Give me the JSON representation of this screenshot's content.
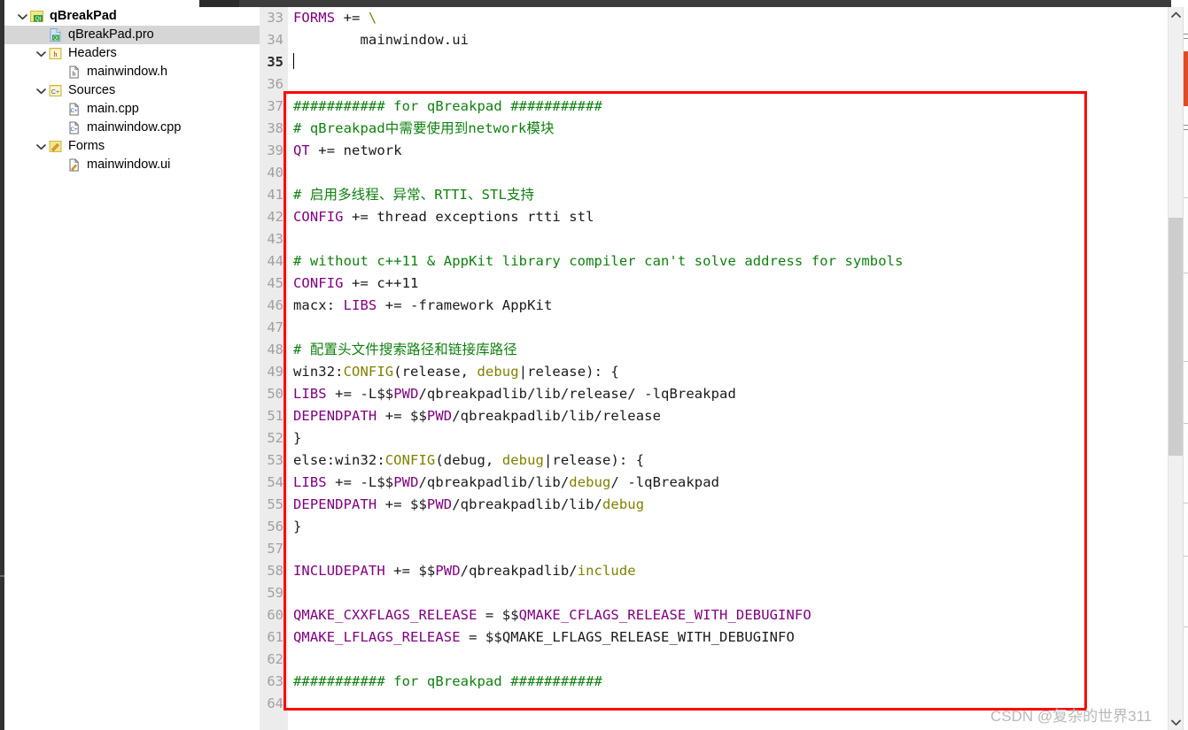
{
  "sidebar": {
    "items": [
      {
        "label": "qBreakPad",
        "icon": "qt-project-icon",
        "indent": 0,
        "chevron": "down",
        "bold": true,
        "selected": false
      },
      {
        "label": "qBreakPad.pro",
        "icon": "pro-file-icon",
        "indent": 1,
        "chevron": "none",
        "bold": false,
        "selected": true
      },
      {
        "label": "Headers",
        "icon": "headers-folder-icon",
        "indent": 1,
        "chevron": "down",
        "bold": false,
        "selected": false
      },
      {
        "label": "mainwindow.h",
        "icon": "header-file-icon",
        "indent": 2,
        "chevron": "none",
        "bold": false,
        "selected": false
      },
      {
        "label": "Sources",
        "icon": "sources-folder-icon",
        "indent": 1,
        "chevron": "down",
        "bold": false,
        "selected": false
      },
      {
        "label": "main.cpp",
        "icon": "cpp-file-icon",
        "indent": 2,
        "chevron": "none",
        "bold": false,
        "selected": false
      },
      {
        "label": "mainwindow.cpp",
        "icon": "cpp-file-icon",
        "indent": 2,
        "chevron": "none",
        "bold": false,
        "selected": false
      },
      {
        "label": "Forms",
        "icon": "forms-folder-icon",
        "indent": 1,
        "chevron": "down",
        "bold": false,
        "selected": false
      },
      {
        "label": "mainwindow.ui",
        "icon": "ui-file-icon",
        "indent": 2,
        "chevron": "none",
        "bold": false,
        "selected": false
      }
    ]
  },
  "editor": {
    "first_line": 33,
    "current_line": 35,
    "lines": [
      {
        "n": 33,
        "tokens": [
          {
            "t": "FORMS",
            "c": "t-var"
          },
          {
            "t": " += ",
            "c": "t-op"
          },
          {
            "t": "\\",
            "c": "t-kw"
          }
        ]
      },
      {
        "n": 34,
        "tokens": [
          {
            "t": "        mainwindow.ui",
            "c": "t-plain"
          }
        ]
      },
      {
        "n": 35,
        "tokens": [],
        "caret": true
      },
      {
        "n": 36,
        "tokens": []
      },
      {
        "n": 37,
        "tokens": [
          {
            "t": "########### for qBreakpad ###########",
            "c": "t-comment"
          }
        ]
      },
      {
        "n": 38,
        "tokens": [
          {
            "t": "# qBreakpad中需要使用到network模块",
            "c": "t-comment"
          }
        ]
      },
      {
        "n": 39,
        "tokens": [
          {
            "t": "QT",
            "c": "t-var"
          },
          {
            "t": " += network",
            "c": "t-plain"
          }
        ]
      },
      {
        "n": 40,
        "tokens": []
      },
      {
        "n": 41,
        "tokens": [
          {
            "t": "# 启用多线程、异常、RTTI、STL支持",
            "c": "t-comment"
          }
        ]
      },
      {
        "n": 42,
        "tokens": [
          {
            "t": "CONFIG",
            "c": "t-var"
          },
          {
            "t": " += thread exceptions rtti stl",
            "c": "t-plain"
          }
        ]
      },
      {
        "n": 43,
        "tokens": []
      },
      {
        "n": 44,
        "tokens": [
          {
            "t": "# without c++11 & AppKit library compiler can't solve address for symbols",
            "c": "t-comment"
          }
        ]
      },
      {
        "n": 45,
        "tokens": [
          {
            "t": "CONFIG",
            "c": "t-var"
          },
          {
            "t": " += c++11",
            "c": "t-plain"
          }
        ]
      },
      {
        "n": 46,
        "tokens": [
          {
            "t": "macx: ",
            "c": "t-plain"
          },
          {
            "t": "LIBS",
            "c": "t-var"
          },
          {
            "t": " += -framework AppKit",
            "c": "t-plain"
          }
        ]
      },
      {
        "n": 47,
        "tokens": []
      },
      {
        "n": 48,
        "tokens": [
          {
            "t": "# 配置头文件搜索路径和链接库路径",
            "c": "t-comment"
          }
        ]
      },
      {
        "n": 49,
        "tokens": [
          {
            "t": "win32:",
            "c": "t-plain"
          },
          {
            "t": "CONFIG",
            "c": "t-kw"
          },
          {
            "t": "(release, ",
            "c": "t-plain"
          },
          {
            "t": "debug",
            "c": "t-kw"
          },
          {
            "t": "|release): {",
            "c": "t-plain"
          }
        ]
      },
      {
        "n": 50,
        "tokens": [
          {
            "t": "LIBS",
            "c": "t-var"
          },
          {
            "t": " += -L$$",
            "c": "t-plain"
          },
          {
            "t": "PWD",
            "c": "t-var"
          },
          {
            "t": "/qbreakpadlib/lib/release/ -lqBreakpad",
            "c": "t-plain"
          }
        ]
      },
      {
        "n": 51,
        "tokens": [
          {
            "t": "DEPENDPATH",
            "c": "t-var"
          },
          {
            "t": " += $$",
            "c": "t-plain"
          },
          {
            "t": "PWD",
            "c": "t-var"
          },
          {
            "t": "/qbreakpadlib/lib/release",
            "c": "t-plain"
          }
        ]
      },
      {
        "n": 52,
        "tokens": [
          {
            "t": "}",
            "c": "t-plain"
          }
        ]
      },
      {
        "n": 53,
        "tokens": [
          {
            "t": "else:win32:",
            "c": "t-plain"
          },
          {
            "t": "CONFIG",
            "c": "t-kw"
          },
          {
            "t": "(debug, ",
            "c": "t-plain"
          },
          {
            "t": "debug",
            "c": "t-kw"
          },
          {
            "t": "|release): {",
            "c": "t-plain"
          }
        ]
      },
      {
        "n": 54,
        "tokens": [
          {
            "t": "LIBS",
            "c": "t-var"
          },
          {
            "t": " += -L$$",
            "c": "t-plain"
          },
          {
            "t": "PWD",
            "c": "t-var"
          },
          {
            "t": "/qbreakpadlib/lib/",
            "c": "t-plain"
          },
          {
            "t": "debug",
            "c": "t-kw"
          },
          {
            "t": "/ -lqBreakpad",
            "c": "t-plain"
          }
        ]
      },
      {
        "n": 55,
        "tokens": [
          {
            "t": "DEPENDPATH",
            "c": "t-var"
          },
          {
            "t": " += $$",
            "c": "t-plain"
          },
          {
            "t": "PWD",
            "c": "t-var"
          },
          {
            "t": "/qbreakpadlib/lib/",
            "c": "t-plain"
          },
          {
            "t": "debug",
            "c": "t-kw"
          }
        ]
      },
      {
        "n": 56,
        "tokens": [
          {
            "t": "}",
            "c": "t-plain"
          }
        ]
      },
      {
        "n": 57,
        "tokens": []
      },
      {
        "n": 58,
        "tokens": [
          {
            "t": "INCLUDEPATH",
            "c": "t-var"
          },
          {
            "t": " += $$",
            "c": "t-plain"
          },
          {
            "t": "PWD",
            "c": "t-var"
          },
          {
            "t": "/qbreakpadlib/",
            "c": "t-plain"
          },
          {
            "t": "include",
            "c": "t-kw"
          }
        ]
      },
      {
        "n": 59,
        "tokens": []
      },
      {
        "n": 60,
        "tokens": [
          {
            "t": "QMAKE_CXXFLAGS_RELEASE",
            "c": "t-var"
          },
          {
            "t": " = $$",
            "c": "t-plain"
          },
          {
            "t": "QMAKE_CFLAGS_RELEASE_WITH_DEBUGINFO",
            "c": "t-var"
          }
        ]
      },
      {
        "n": 61,
        "tokens": [
          {
            "t": "QMAKE_LFLAGS_RELEASE",
            "c": "t-var"
          },
          {
            "t": " = $$",
            "c": "t-plain"
          },
          {
            "t": "QMAKE_LFLAGS_RELEASE_WITH_DEBUGINFO",
            "c": "t-plain"
          }
        ]
      },
      {
        "n": 62,
        "tokens": []
      },
      {
        "n": 63,
        "tokens": [
          {
            "t": "########### for qBreakpad ###########",
            "c": "t-comment"
          }
        ]
      },
      {
        "n": 64,
        "tokens": []
      }
    ]
  },
  "annotation": {
    "color": "#fa0a0a",
    "label": "red-highlight-rectangle"
  },
  "watermark": {
    "text": "CSDN @复杂的世界311"
  },
  "scrollbar": {
    "up_glyph": "▲",
    "down_glyph": "▼"
  },
  "colors": {
    "comment": "#108010",
    "variable": "#800080",
    "keyword": "#808000",
    "plain": "#1a1a1a",
    "gutter_bg": "#ececec",
    "selection_bg": "#d6d6d6",
    "annotation_red": "#fa0a0a",
    "minimap_marker": "#e24a21"
  }
}
